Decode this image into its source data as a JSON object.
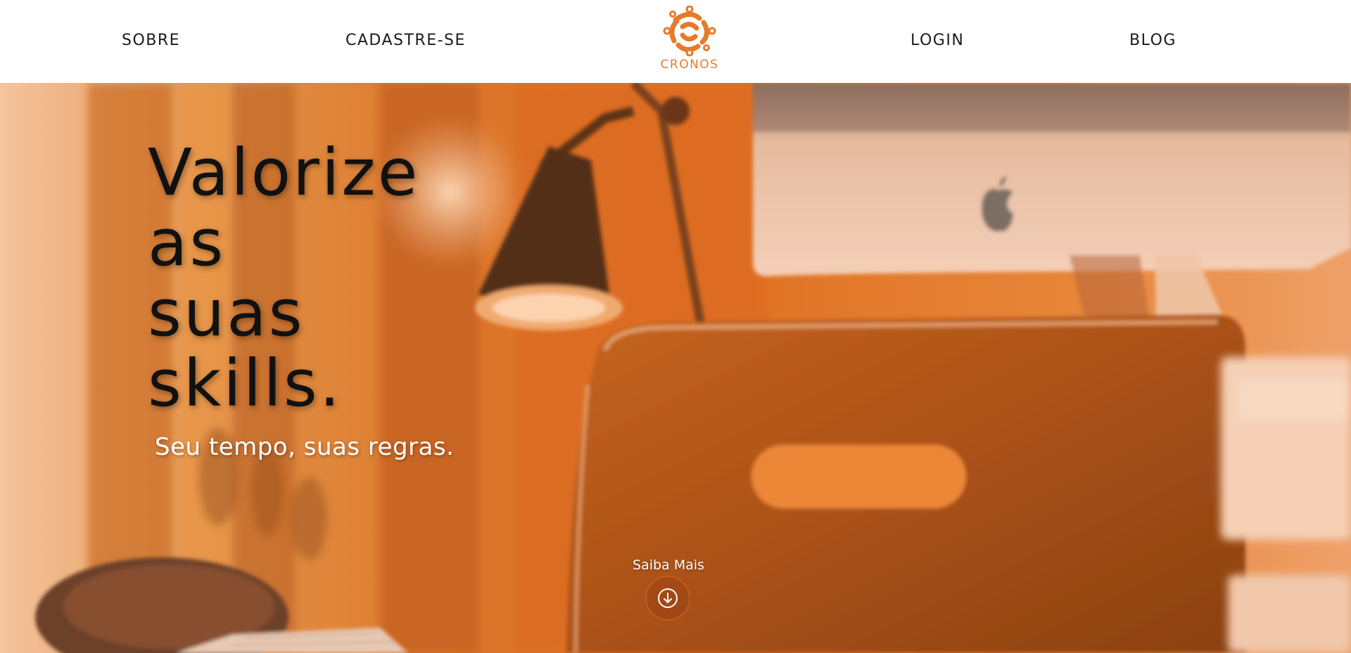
{
  "header": {
    "nav_left": [
      {
        "label": "SOBRE"
      },
      {
        "label": "CADASTRE-SE"
      }
    ],
    "nav_right": [
      {
        "label": "LOGIN"
      },
      {
        "label": "BLOG"
      }
    ],
    "logo": {
      "text": "CRONOS",
      "icon": "circuit-knot-icon"
    }
  },
  "hero": {
    "headline_lines": [
      "Valorize",
      "as",
      "suas",
      "skills."
    ],
    "subtitle": "Seu tempo, suas regras.",
    "cta": {
      "label": "Saiba Mais",
      "icon": "arrow-down-circle-icon"
    }
  },
  "colors": {
    "brand_orange": "#e57b2c",
    "hero_tint": "#d96a22",
    "nav_text": "#1b1b1b",
    "headline_text": "#111111",
    "subtitle_text": "#ffffff"
  }
}
